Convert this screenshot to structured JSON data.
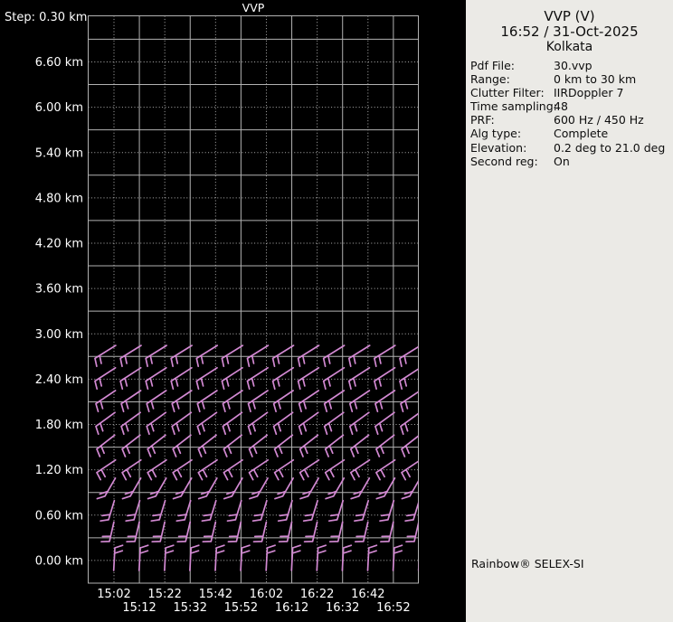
{
  "colors": {
    "background": "#000000",
    "grid": "#b2b2b2",
    "chart_text": "#ffffff",
    "barbs": "#d289d2",
    "panel_bg": "#ebeae6",
    "panel_text": "#0d0d0d"
  },
  "chart_data": {
    "type": "wind-barb-profile",
    "title": "VVP",
    "step_label": "Step: 0.30 km",
    "x_axis": {
      "tick_labels": [
        "15:02",
        "15:12",
        "15:22",
        "15:32",
        "15:42",
        "15:52",
        "16:02",
        "16:12",
        "16:22",
        "16:32",
        "16:42",
        "16:52"
      ],
      "label_layout": "staggered-two-rows",
      "grid": "solid lines on odd ticks, dotted lines on even ticks"
    },
    "y_axis": {
      "unit": "km",
      "labels": [
        "6.60 km",
        "6.00 km",
        "5.40 km",
        "4.80 km",
        "4.20 km",
        "3.60 km",
        "3.00 km",
        "2.40 km",
        "1.80 km",
        "1.20 km",
        "0.60 km",
        "0.00 km"
      ],
      "min_km": 0.0,
      "max_km": 6.6,
      "label_step_km": 0.6,
      "profile_step_km": 0.3,
      "grid": "dotted lines at labeled heights, solid lines at band boundaries"
    },
    "barb_columns": 13,
    "levels": [
      {
        "height_km": 2.7,
        "dir_from_deg_approx": 238,
        "speed_kt_approx": 15,
        "glyph": {
          "ex": -21,
          "ey": 2,
          "staff_deg": 58,
          "staff_len": 27,
          "feather_deg": 168,
          "feather_len": 9,
          "n_feathers": 2,
          "feather_spacing": 6
        }
      },
      {
        "height_km": 2.4,
        "dir_from_deg_approx": 237,
        "speed_kt_approx": 15,
        "glyph": {
          "ex": -21,
          "ey": 2,
          "staff_deg": 57,
          "staff_len": 27,
          "feather_deg": 166,
          "feather_len": 9,
          "n_feathers": 2,
          "feather_spacing": 6
        }
      },
      {
        "height_km": 2.1,
        "dir_from_deg_approx": 236,
        "speed_kt_approx": 15,
        "glyph": {
          "ex": -20,
          "ey": 2,
          "staff_deg": 56,
          "staff_len": 26,
          "feather_deg": 164,
          "feather_len": 9,
          "n_feathers": 2,
          "feather_spacing": 6
        }
      },
      {
        "height_km": 1.8,
        "dir_from_deg_approx": 234,
        "speed_kt_approx": 15,
        "glyph": {
          "ex": -20,
          "ey": 2,
          "staff_deg": 54,
          "staff_len": 26,
          "feather_deg": 162,
          "feather_len": 9,
          "n_feathers": 2,
          "feather_spacing": 6
        }
      },
      {
        "height_km": 1.5,
        "dir_from_deg_approx": 232,
        "speed_kt_approx": 15,
        "glyph": {
          "ex": -19,
          "ey": 2,
          "staff_deg": 52,
          "staff_len": 25,
          "feather_deg": 158,
          "feather_len": 9,
          "n_feathers": 2,
          "feather_spacing": 6
        }
      },
      {
        "height_km": 1.2,
        "dir_from_deg_approx": 236,
        "speed_kt_approx": 15,
        "glyph": {
          "ex": -19,
          "ey": 3,
          "staff_deg": 56,
          "staff_len": 25,
          "feather_deg": 152,
          "feather_len": 9,
          "n_feathers": 2,
          "feather_spacing": 6
        }
      },
      {
        "height_km": 0.9,
        "dir_from_deg_approx": 210,
        "speed_kt_approx": 15,
        "glyph": {
          "ex": -10,
          "ey": 4,
          "staff_deg": 30,
          "staff_len": 23,
          "feather_deg": 252,
          "feather_len": 9,
          "n_feathers": 2,
          "feather_spacing": 6
        }
      },
      {
        "height_km": 0.6,
        "dir_from_deg_approx": 197,
        "speed_kt_approx": 15,
        "glyph": {
          "ex": -6,
          "ey": 5,
          "staff_deg": 17,
          "staff_len": 22,
          "feather_deg": 262,
          "feather_len": 9,
          "n_feathers": 2,
          "feather_spacing": 6
        }
      },
      {
        "height_km": 0.3,
        "dir_from_deg_approx": 193,
        "speed_kt_approx": 15,
        "glyph": {
          "ex": -5,
          "ey": 4,
          "staff_deg": 13,
          "staff_len": 22,
          "feather_deg": 268,
          "feather_len": 9,
          "n_feathers": 2,
          "feather_spacing": 6
        }
      },
      {
        "height_km": 0.0,
        "dir_from_deg_approx": 3,
        "speed_kt_approx": 15,
        "glyph": {
          "ex": 1,
          "ey": -14,
          "staff_deg": 183,
          "staff_len": 25,
          "feather_deg": 72,
          "feather_len": 9,
          "n_feathers": 2,
          "feather_spacing": 6
        }
      }
    ]
  },
  "panel": {
    "title": "VVP (V)",
    "datetime": "16:52 / 31-Oct-2025",
    "site": "Kolkata",
    "fields": [
      {
        "label": "Pdf File:",
        "value": "30.vvp"
      },
      {
        "label": "Range:",
        "value": "0 km to 30 km"
      },
      {
        "label": "Clutter Filter:",
        "value": "IIRDoppler 7"
      },
      {
        "label": "Time sampling:",
        "value": "48"
      },
      {
        "label": "PRF:",
        "value": "600 Hz / 450 Hz"
      },
      {
        "label": "Alg type:",
        "value": "Complete"
      },
      {
        "label": "Elevation:",
        "value": "0.2 deg to 21.0 deg"
      },
      {
        "label": "Second reg:",
        "value": "On"
      }
    ],
    "brand": "Rainbow® SELEX-SI"
  }
}
